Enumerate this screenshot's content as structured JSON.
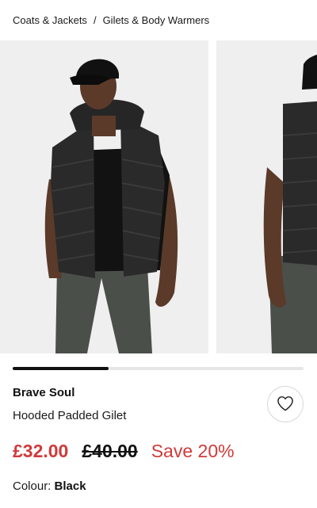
{
  "breadcrumb": {
    "items": [
      "Coats & Jackets",
      "Gilets & Body Warmers"
    ],
    "separator": "/"
  },
  "gallery": {
    "image_count_visible": 2,
    "progress_fraction": 0.33
  },
  "product": {
    "brand": "Brave Soul",
    "name": "Hooded Padded Gilet",
    "price_now": "£32.00",
    "price_was": "£40.00",
    "save": "Save 20%",
    "colour_label": "Colour:",
    "colour_value": "Black"
  },
  "icons": {
    "wishlist": "heart-icon"
  },
  "colors": {
    "sale_red": "#d03a3a",
    "text": "#1a1a1a",
    "track": "#e6e6e6",
    "track_fill": "#111111"
  }
}
